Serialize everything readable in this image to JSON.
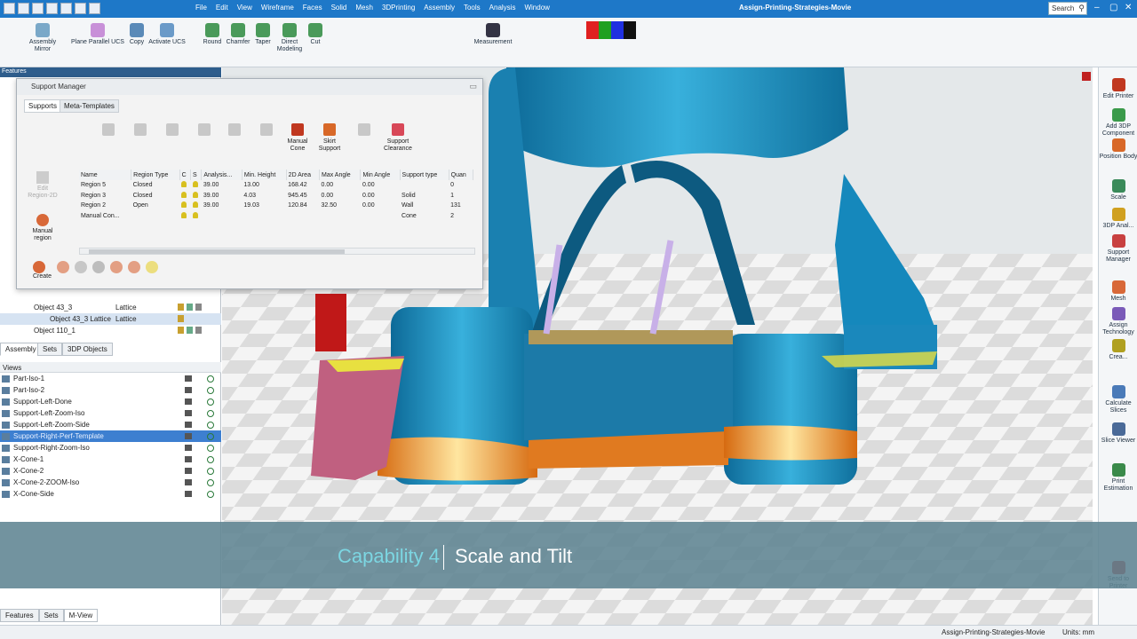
{
  "title": "Assign-Printing-Strategies-Movie",
  "menus": [
    "File",
    "Edit",
    "View",
    "Wireframe",
    "Faces",
    "Solid",
    "Mesh",
    "3DPrinting",
    "Assembly",
    "Tools",
    "Analysis",
    "Window"
  ],
  "search": {
    "label": "Search"
  },
  "ribbon": [
    "Assembly Mirror",
    "Plane Parallel UCS",
    "Copy",
    "Activate UCS",
    "Round",
    "Chamfer",
    "Taper",
    "Direct Modeling",
    "Cut",
    "Measurement"
  ],
  "leftpane": {
    "header": "Features",
    "tabs": [
      "Assembly",
      "Sets",
      "3DP Objects"
    ],
    "objects": [
      {
        "name": "Object 43_3",
        "type": "Lattice"
      },
      {
        "name": "Object 43_3 Lattice",
        "type": "Lattice"
      },
      {
        "name": "Object 110_1",
        "type": ""
      }
    ],
    "views_header": "Views",
    "views": [
      "Part-Iso-1",
      "Part-Iso-2",
      "Support-Left-Done",
      "Support-Left-Zoom-Iso",
      "Support-Left-Zoom-Side",
      "Support-Right-Perf-Template",
      "Support-Right-Zoom-Iso",
      "X-Cone-1",
      "X-Cone-2",
      "X-Cone-2-ZOOM-Iso",
      "X-Cone-Side"
    ],
    "bottom_tabs": [
      "Features",
      "Sets",
      "M-View"
    ]
  },
  "dialog": {
    "title": "Support Manager",
    "tabs": [
      "Supports",
      "Meta-Templates"
    ],
    "tools": [
      {
        "label": "Manual Cone",
        "enabled": true
      },
      {
        "label": "Skirt Support",
        "enabled": true
      },
      {
        "label": "Support Clearance",
        "enabled": true
      }
    ],
    "side": [
      "Edit Region-2D",
      "Manual region",
      "Create"
    ],
    "columns": [
      "Name",
      "Region Type",
      "C",
      "S",
      "Analysis...",
      "Min. Height",
      "2D Area",
      "Max Angle",
      "Min Angle",
      "Support type",
      "Quan"
    ],
    "rows": [
      [
        "Region 5",
        "Closed",
        "39.00",
        "13.00",
        "168.42",
        "0.00",
        "0.00",
        "",
        "0"
      ],
      [
        "Region 3",
        "Closed",
        "39.00",
        "4.03",
        "945.45",
        "0.00",
        "0.00",
        "Solid",
        "1"
      ],
      [
        "Region 2",
        "Open",
        "39.00",
        "19.03",
        "120.84",
        "32.50",
        "0.00",
        "Wall",
        "131"
      ],
      [
        "Manual Con...",
        "",
        "",
        "",
        "",
        "",
        "",
        "Cone",
        "2"
      ]
    ]
  },
  "rightbar": [
    "Edit Printer",
    "Add 3DP Component",
    "Position Body",
    "Scale",
    "3DP Anal...",
    "Support Manager",
    "Mesh",
    "Assign Technology",
    "Crea...",
    "Calculate Slices",
    "Slice Viewer",
    "Print Estimation",
    "Send to Printer"
  ],
  "banner": {
    "capability": "Capability 4",
    "title": "Scale and Tilt"
  },
  "status": {
    "doc": "Assign-Printing-Strategies-Movie",
    "units": "Units: mm"
  },
  "colors": {
    "titlebar": "#1e78c8",
    "part": "#1e8fc0",
    "base": "#e07a20",
    "lattice": "#c06080",
    "banner": "#5e8492",
    "accent": "#7cd6e2"
  }
}
